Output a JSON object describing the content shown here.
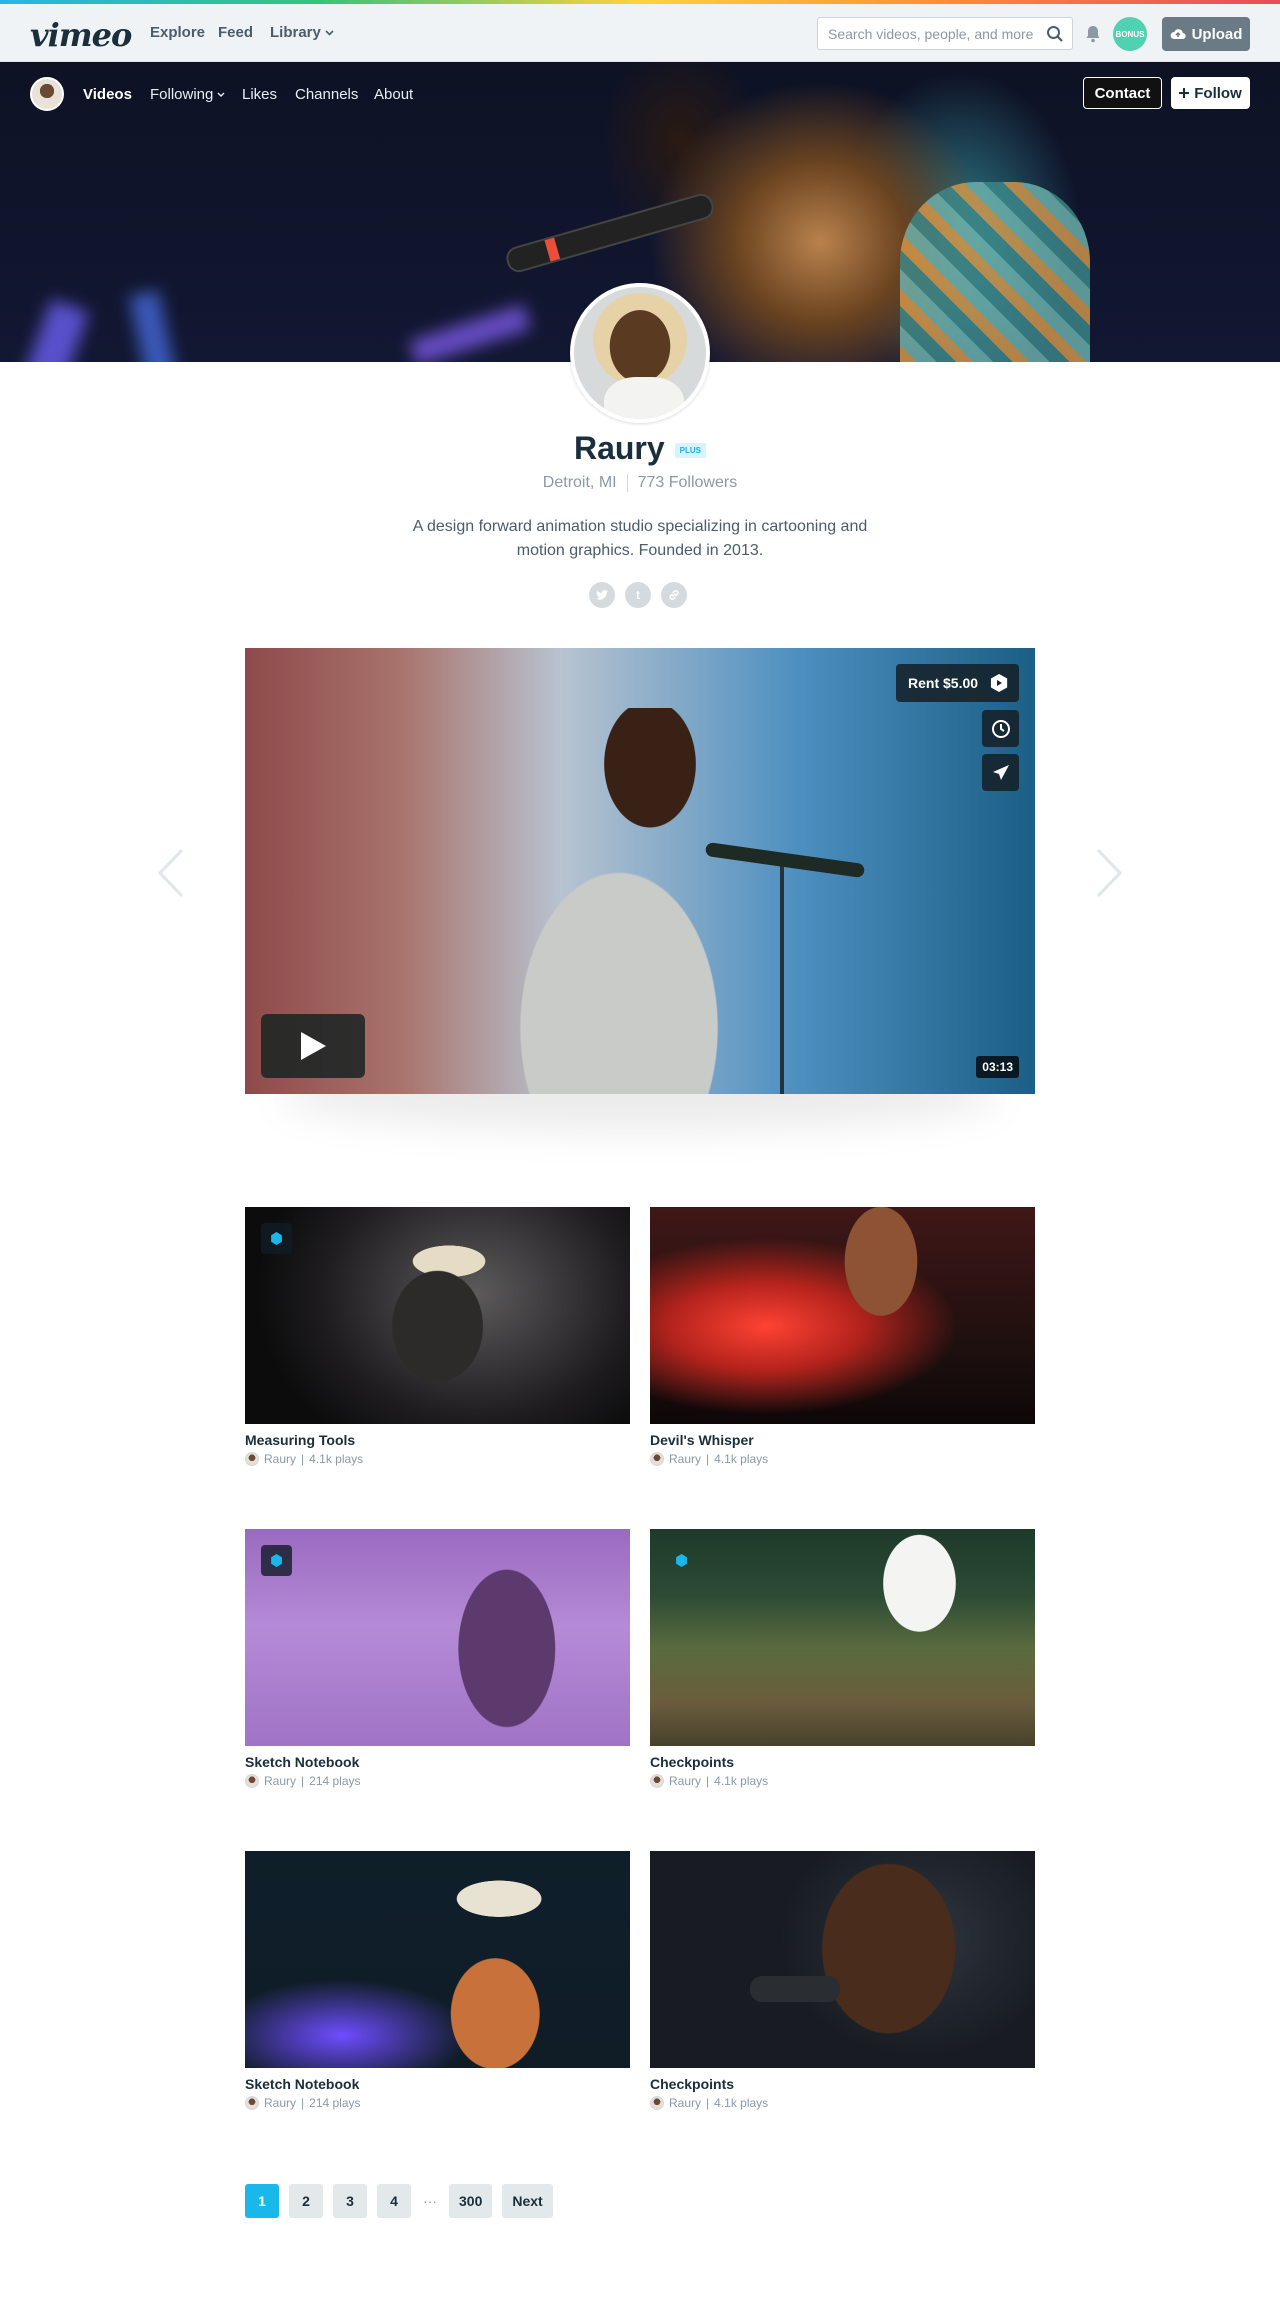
{
  "topnav": {
    "logo": "vimeo",
    "explore": "Explore",
    "feed": "Feed",
    "library": "Library",
    "search_placeholder": "Search videos, people, and more",
    "avatar_label": "BONUS",
    "upload": "Upload"
  },
  "subnav": {
    "videos": "Videos",
    "following": "Following",
    "likes": "Likes",
    "channels": "Channels",
    "about": "About",
    "contact": "Contact",
    "follow": "Follow"
  },
  "profile": {
    "name": "Raury",
    "badge": "PLUS",
    "location": "Detroit, MI",
    "followers": "773 Followers",
    "bio": "A design forward animation studio specializing in cartooning and motion graphics. Founded in 2013.",
    "socials": [
      "twitter-icon",
      "tumblr-icon",
      "link-icon"
    ]
  },
  "featured": {
    "rent_label": "Rent $5.00",
    "duration": "03:13"
  },
  "videos": [
    {
      "title": "Measuring Tools",
      "author": "Raury",
      "plays": "4.1k plays",
      "staff_pick": true
    },
    {
      "title": "Devil's Whisper",
      "author": "Raury",
      "plays": "4.1k plays",
      "staff_pick": false
    },
    {
      "title": "Sketch Notebook",
      "author": "Raury",
      "plays": "214 plays",
      "staff_pick": true
    },
    {
      "title": "Checkpoints",
      "author": "Raury",
      "plays": "4.1k plays",
      "staff_pick": true
    },
    {
      "title": "Sketch Notebook",
      "author": "Raury",
      "plays": "214 plays",
      "staff_pick": false
    },
    {
      "title": "Checkpoints",
      "author": "Raury",
      "plays": "4.1k plays",
      "staff_pick": false
    }
  ],
  "pagination": {
    "pages": [
      "1",
      "2",
      "3",
      "4"
    ],
    "ellipsis": "···",
    "last": "300",
    "next": "Next",
    "current": "1"
  },
  "colors": {
    "accent": "#1ab7ea",
    "text": "#1a2e3b",
    "muted": "#8a9aa5"
  }
}
